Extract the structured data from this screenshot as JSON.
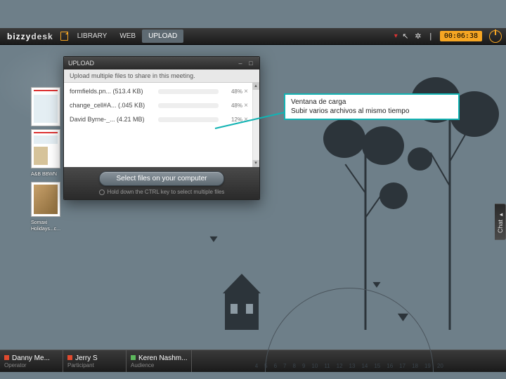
{
  "brand": {
    "a": "bizzy",
    "b": "desk"
  },
  "nav": {
    "library": "LIBRARY",
    "web": "WEB",
    "upload": "UPLOAD"
  },
  "clock": "00:06:38",
  "chat_tab": "Chat",
  "sidebar": {
    "label1": "A&B\nBBWN",
    "label2": "Somaxi\nHolidays...c..."
  },
  "upload": {
    "window_title": "UPLOAD",
    "subtitle": "Upload multiple files to share in this meeting.",
    "files": [
      {
        "name": "formfields.pn... (513.4 KB)",
        "pct": "48%",
        "w": 48
      },
      {
        "name": "change_cell#A... (.045 KB)",
        "pct": "48%",
        "w": 48
      },
      {
        "name": "David Byrne-_... (4.21 MB)",
        "pct": "12%",
        "w": 12
      }
    ],
    "select_button": "Select files on your computer",
    "hint": "Hold down the CTRL key to select multiple files"
  },
  "annotation": {
    "line1": "Ventana de carga",
    "line2": "Subir varios archivos al mismo tiempo"
  },
  "participants": [
    {
      "name": "Danny Me...",
      "role": "Operator",
      "color": "r"
    },
    {
      "name": "Jerry S",
      "role": "Participant",
      "color": "r"
    },
    {
      "name": "Keren Nashm...",
      "role": "Audience",
      "color": "g"
    }
  ],
  "dial_ticks": [
    "4",
    "5",
    "6",
    "7",
    "8",
    "9",
    "10",
    "11",
    "12",
    "13",
    "14",
    "15",
    "16",
    "17",
    "18",
    "19",
    "20"
  ]
}
